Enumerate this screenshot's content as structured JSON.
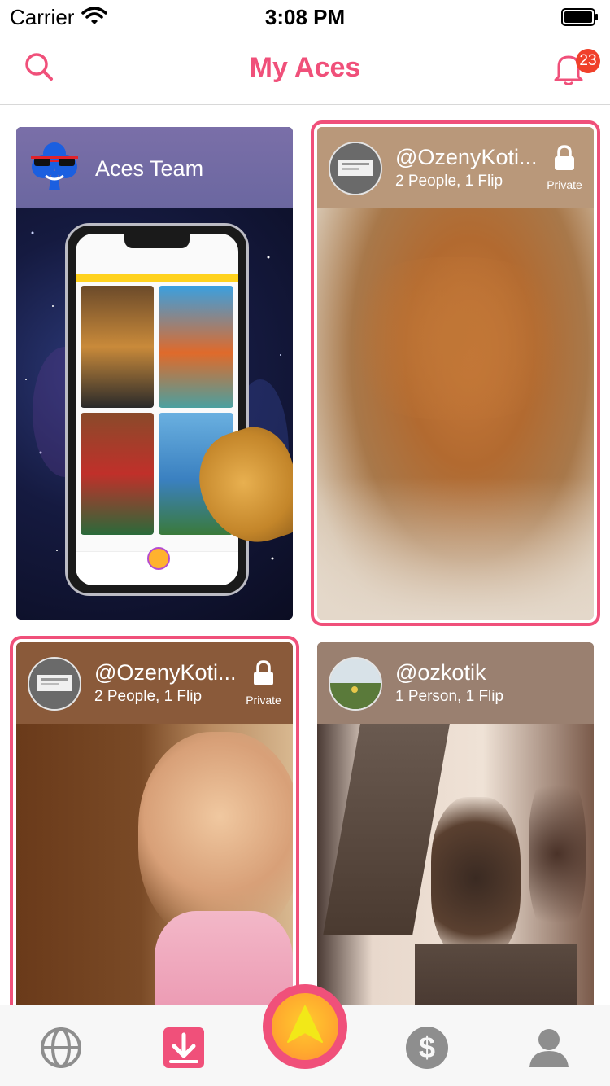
{
  "status_bar": {
    "carrier": "Carrier",
    "time": "3:08 PM"
  },
  "nav": {
    "title": "My Aces",
    "left_icon": "search-icon",
    "right_icon": "bell-icon",
    "notification_count": "23"
  },
  "cards": [
    {
      "title": "Aces Team",
      "subtitle": "",
      "private": false,
      "selected": false
    },
    {
      "title": "@OzenyKoti...",
      "subtitle": "2 People, 1 Flip",
      "private": true,
      "private_label": "Private",
      "selected": true
    },
    {
      "title": "@OzenyKoti...",
      "subtitle": "2 People, 1 Flip",
      "private": true,
      "private_label": "Private",
      "selected": true
    },
    {
      "title": "@ozkotik",
      "subtitle": "1 Person, 1 Flip",
      "private": false,
      "selected": false
    }
  ],
  "tab_bar": {
    "items": [
      "globe-icon",
      "inbox-download-icon",
      "aces-create-icon",
      "dollar-icon",
      "profile-icon"
    ],
    "active": "inbox-download-icon"
  },
  "colors": {
    "accent": "#f0507a",
    "badge": "#f0402a",
    "center_button": "#ffb22e"
  }
}
